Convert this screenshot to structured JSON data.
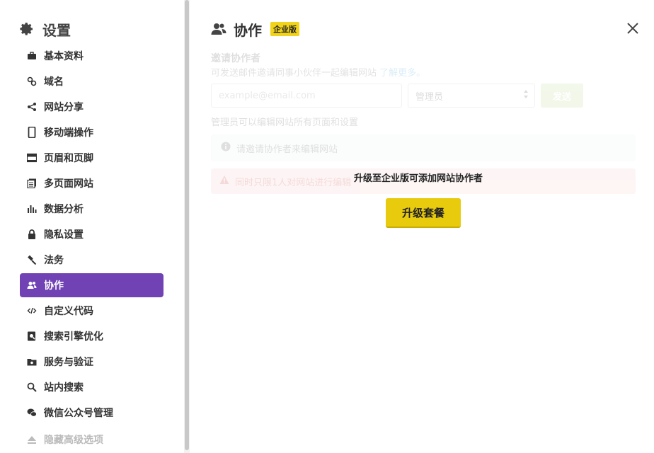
{
  "sidebar": {
    "title": "设置",
    "items": [
      {
        "label": "基本资料",
        "icon": "briefcase-icon"
      },
      {
        "label": "域名",
        "icon": "link-icon"
      },
      {
        "label": "网站分享",
        "icon": "share-icon"
      },
      {
        "label": "移动端操作",
        "icon": "mobile-icon"
      },
      {
        "label": "页眉和页脚",
        "icon": "header-footer-icon"
      },
      {
        "label": "多页面网站",
        "icon": "pages-icon"
      },
      {
        "label": "数据分析",
        "icon": "bar-chart-icon"
      },
      {
        "label": "隐私设置",
        "icon": "lock-icon"
      },
      {
        "label": "法务",
        "icon": "gavel-icon"
      },
      {
        "label": "协作",
        "icon": "users-icon",
        "active": true
      },
      {
        "label": "自定义代码",
        "icon": "code-icon"
      },
      {
        "label": "搜索引擎优化",
        "icon": "seo-icon"
      },
      {
        "label": "服务与验证",
        "icon": "folder-badge-icon"
      },
      {
        "label": "站内搜索",
        "icon": "search-icon"
      },
      {
        "label": "微信公众号管理",
        "icon": "wechat-icon"
      }
    ],
    "advanced_toggle": "隐藏高级选项"
  },
  "main": {
    "title": "协作",
    "badge": "企业版",
    "invite": {
      "heading": "邀请协作者",
      "description": "可发送邮件邀请同事小伙伴一起编辑网站",
      "learn_more": "了解更多。",
      "email_placeholder": "example@email.com",
      "role_value": "管理员",
      "send_label": "发送",
      "role_note": "管理员可以编辑网站所有页面和设置",
      "info_text": "请邀请协作者来编辑网站",
      "warn_text": "同时只限1人对网站进行编辑"
    },
    "upgrade": {
      "message": "升级至企业版可添加网站协作者",
      "button": "升级套餐"
    }
  },
  "colors": {
    "accent": "#7042b4",
    "upgrade": "#e8cb0d",
    "badge": "#f0d31a",
    "link": "#3aa0d8",
    "send": "#b9d88c",
    "warning_bg": "#f7c9c9"
  }
}
